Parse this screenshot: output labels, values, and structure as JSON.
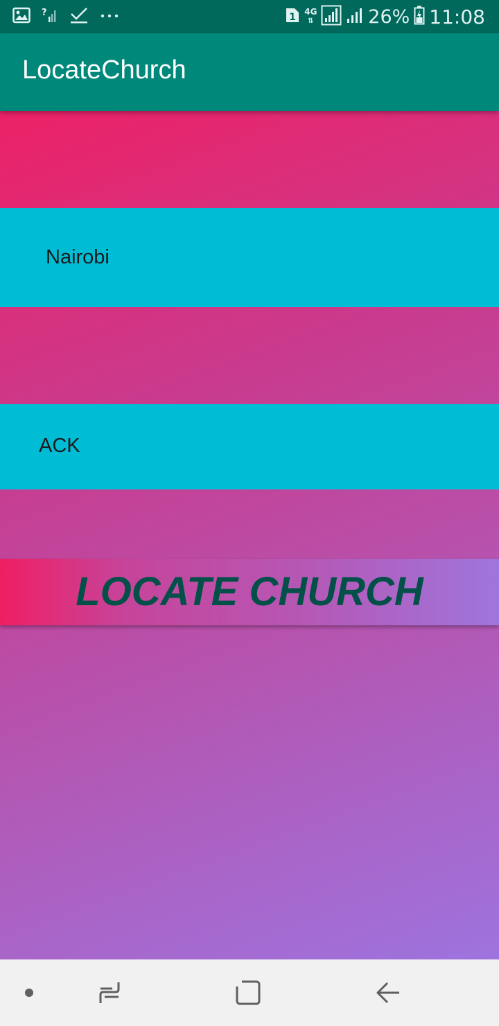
{
  "status_bar": {
    "network_type": "4G",
    "battery_percent": "26%",
    "time": "11:08",
    "sim_badge": "1",
    "icons": {
      "left": [
        "image-icon",
        "signal-unknown-icon",
        "check-icon",
        "more-dots-icon"
      ],
      "right": [
        "sim-1-icon",
        "network-4g-icon",
        "signal-icon",
        "signal-secondary-icon",
        "battery-charging-icon"
      ]
    }
  },
  "app_bar": {
    "title": "LocateChurch"
  },
  "form": {
    "city_value": "Nairobi",
    "denomination_value": "ACK",
    "locate_button_label": "LOCATE CHURCH"
  },
  "colors": {
    "status_bar": "#00695c",
    "app_bar": "#00897b",
    "field_background": "#00bcd4",
    "gradient_start": "#ec2166",
    "gradient_end": "#9e73de",
    "button_text": "#035049"
  },
  "nav_bar": {
    "icons": [
      "dot-icon",
      "recent-apps-icon",
      "home-icon",
      "back-icon"
    ]
  }
}
